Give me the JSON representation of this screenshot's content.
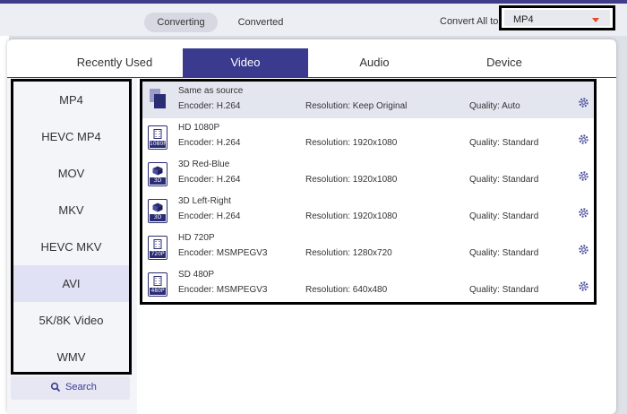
{
  "header": {
    "tabs": [
      {
        "label": "Converting",
        "active": true
      },
      {
        "label": "Converted",
        "active": false
      }
    ],
    "convert_all_label": "Convert All to:",
    "selected_format": "MP4"
  },
  "panel": {
    "tabs": [
      {
        "label": "Recently Used",
        "active": false
      },
      {
        "label": "Video",
        "active": true
      },
      {
        "label": "Audio",
        "active": false
      },
      {
        "label": "Device",
        "active": false
      }
    ],
    "formats": [
      {
        "label": "MP4",
        "selected": false
      },
      {
        "label": "HEVC MP4",
        "selected": false
      },
      {
        "label": "MOV",
        "selected": false
      },
      {
        "label": "MKV",
        "selected": false
      },
      {
        "label": "HEVC MKV",
        "selected": false
      },
      {
        "label": "AVI",
        "selected": true
      },
      {
        "label": "5K/8K Video",
        "selected": false
      },
      {
        "label": "WMV",
        "selected": false
      }
    ],
    "search_label": "Search",
    "presets": [
      {
        "name": "Same as source",
        "encoder": "Encoder: H.264",
        "resolution": "Resolution: Keep Original",
        "quality": "Quality: Auto",
        "icon": "same-as-source-icon",
        "badge": ""
      },
      {
        "name": "HD 1080P",
        "encoder": "Encoder: H.264",
        "resolution": "Resolution: 1920x1080",
        "quality": "Quality: Standard",
        "icon": "film-1080p-icon",
        "badge": "1080P"
      },
      {
        "name": "3D Red-Blue",
        "encoder": "Encoder: H.264",
        "resolution": "Resolution: 1920x1080",
        "quality": "Quality: Standard",
        "icon": "cube-3d-icon",
        "badge": "3D"
      },
      {
        "name": "3D Left-Right",
        "encoder": "Encoder: H.264",
        "resolution": "Resolution: 1920x1080",
        "quality": "Quality: Standard",
        "icon": "cube-3d-icon",
        "badge": "3D"
      },
      {
        "name": "HD 720P",
        "encoder": "Encoder: MSMPEGV3",
        "resolution": "Resolution: 1280x720",
        "quality": "Quality: Standard",
        "icon": "film-720p-icon",
        "badge": "720P"
      },
      {
        "name": "SD 480P",
        "encoder": "Encoder: MSMPEGV3",
        "resolution": "Resolution: 640x480",
        "quality": "Quality: Standard",
        "icon": "film-480p-icon",
        "badge": "480P"
      }
    ]
  },
  "colors": {
    "accent": "#3a3b8f",
    "caret": "#e24a2a"
  }
}
